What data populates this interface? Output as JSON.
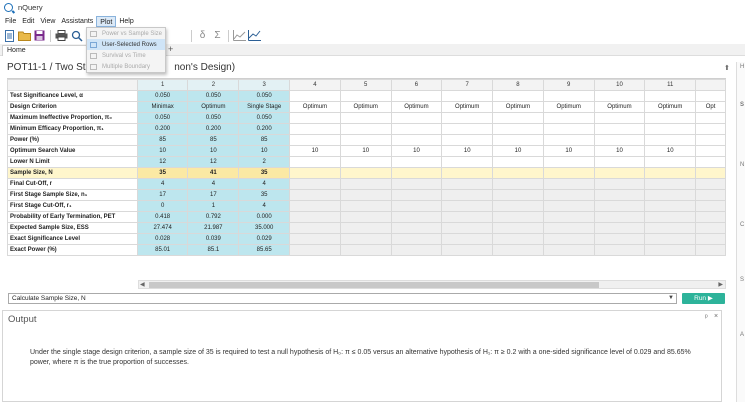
{
  "window": {
    "title": "nQuery"
  },
  "menu": [
    "File",
    "Edit",
    "View",
    "Assistants",
    "Plot",
    "Help"
  ],
  "plot_menu": {
    "items": [
      {
        "label": "Power vs Sample Size",
        "enabled": false
      },
      {
        "label": "User-Selected Rows",
        "enabled": true
      },
      {
        "label": "Survival vs Time",
        "enabled": false
      },
      {
        "label": "Multiple Boundary",
        "enabled": false
      }
    ]
  },
  "toolbar": {
    "delta_glyph": "δ",
    "sigma_glyph": "Σ"
  },
  "tabs": {
    "home": "Home",
    "close": "×",
    "add": "+"
  },
  "document": {
    "title": "POT11-1 / Two Stage",
    "title_suffix": "non's Design)"
  },
  "grid": {
    "columns": [
      "1",
      "2",
      "3",
      "4",
      "5",
      "6",
      "7",
      "8",
      "9",
      "10",
      "11"
    ],
    "rows": [
      {
        "label": "Test Significance Level, α",
        "values": [
          "0.050",
          "0.050",
          "0.050",
          "",
          "",
          "",
          "",
          "",
          "",
          "",
          ""
        ]
      },
      {
        "label": "Design Criterion",
        "values": [
          "Minimax",
          "Optimum",
          "Single Stage",
          "Optimum",
          "Optimum",
          "Optimum",
          "Optimum",
          "Optimum",
          "Optimum",
          "Optimum",
          "Optimum",
          "Opt"
        ]
      },
      {
        "label": "Maximum Ineffective Proportion, π₀",
        "values": [
          "0.050",
          "0.050",
          "0.050",
          "",
          "",
          "",
          "",
          "",
          "",
          "",
          ""
        ]
      },
      {
        "label": "Minimum Efficacy Proportion, π₁",
        "values": [
          "0.200",
          "0.200",
          "0.200",
          "",
          "",
          "",
          "",
          "",
          "",
          "",
          ""
        ]
      },
      {
        "label": "Power (%)",
        "values": [
          "85",
          "85",
          "85",
          "",
          "",
          "",
          "",
          "",
          "",
          "",
          ""
        ]
      },
      {
        "label": "Optimum Search Value",
        "values": [
          "10",
          "10",
          "10",
          "10",
          "10",
          "10",
          "10",
          "10",
          "10",
          "10",
          "10"
        ]
      },
      {
        "label": "Lower N Limit",
        "values": [
          "12",
          "12",
          "2",
          "",
          "",
          "",
          "",
          "",
          "",
          "",
          ""
        ]
      },
      {
        "label": "Sample Size, N",
        "values": [
          "35",
          "41",
          "35",
          "",
          "",
          "",
          "",
          "",
          "",
          "",
          ""
        ]
      },
      {
        "label": "Final Cut-Off, r",
        "values": [
          "4",
          "4",
          "4",
          "",
          "",
          "",
          "",
          "",
          "",
          "",
          ""
        ]
      },
      {
        "label": "First Stage Sample Size, n₁",
        "values": [
          "17",
          "17",
          "35",
          "",
          "",
          "",
          "",
          "",
          "",
          "",
          ""
        ]
      },
      {
        "label": "First Stage Cut-Off, r₁",
        "values": [
          "0",
          "1",
          "4",
          "",
          "",
          "",
          "",
          "",
          "",
          "",
          ""
        ]
      },
      {
        "label": "Probability of Early Termination, PET",
        "values": [
          "0.418",
          "0.792",
          "0.000",
          "",
          "",
          "",
          "",
          "",
          "",
          "",
          ""
        ]
      },
      {
        "label": "Expected Sample Size, ESS",
        "values": [
          "27.474",
          "21.987",
          "35.000",
          "",
          "",
          "",
          "",
          "",
          "",
          "",
          ""
        ]
      },
      {
        "label": "Exact Significance Level",
        "values": [
          "0.028",
          "0.039",
          "0.029",
          "",
          "",
          "",
          "",
          "",
          "",
          "",
          ""
        ]
      },
      {
        "label": "Exact Power (%)",
        "values": [
          "85.01",
          "85.1",
          "85.65",
          "",
          "",
          "",
          "",
          "",
          "",
          "",
          ""
        ]
      }
    ]
  },
  "calc": {
    "label": "Calculate Sample Size, N",
    "run": "Run ▶"
  },
  "output": {
    "title": "Output",
    "text": "Under the single stage design criterion, a sample size of 35 is required to test a null hypothesis of H₀: π ≤ 0.05 versus an alternative hypothesis of H₁: π ≥ 0.2 with a one-sided significance level of 0.029 and 85.65% power, where π is the true proportion of successes."
  }
}
